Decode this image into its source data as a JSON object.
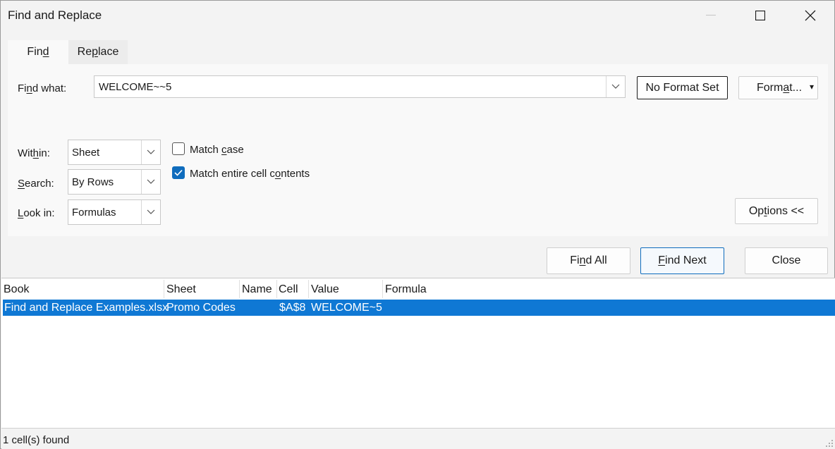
{
  "window": {
    "title": "Find and Replace"
  },
  "tabs": [
    {
      "pre": "Fin",
      "key": "d",
      "post": ""
    },
    {
      "pre": "Re",
      "key": "p",
      "post": "lace"
    }
  ],
  "find_what": {
    "label_pre": "Fi",
    "label_key": "n",
    "label_post": "d what:",
    "value": "WELCOME~~5"
  },
  "format_status": "No Format Set",
  "format_button": {
    "pre": "Form",
    "key": "a",
    "post": "t..."
  },
  "within": {
    "label_pre": "Wit",
    "label_key": "h",
    "label_post": "in:",
    "value": "Sheet"
  },
  "search": {
    "label_pre": "",
    "label_key": "S",
    "label_post": "earch:",
    "value": "By Rows"
  },
  "look_in": {
    "label_pre": "",
    "label_key": "L",
    "label_post": "ook in:",
    "value": "Formulas"
  },
  "match_case": {
    "pre": "Match ",
    "key": "c",
    "post": "ase",
    "checked": false
  },
  "match_entire": {
    "pre": "Match entire cell c",
    "key": "o",
    "post": "ntents",
    "checked": true
  },
  "options_button": {
    "pre": "Op",
    "key": "t",
    "post": "ions <<"
  },
  "find_all_button": {
    "pre": "Fi",
    "key": "n",
    "post": "d All"
  },
  "find_next_button": {
    "pre": "",
    "key": "F",
    "post": "ind Next"
  },
  "close_button": "Close",
  "results": {
    "columns": [
      "Book",
      "Sheet",
      "Name",
      "Cell",
      "Value",
      "Formula"
    ],
    "rows": [
      {
        "book": "Find and Replace Examples.xlsx",
        "sheet": "Promo Codes",
        "name": "",
        "cell": "$A$8",
        "value": "WELCOME~5",
        "formula": ""
      }
    ]
  },
  "status": "1 cell(s) found",
  "colors": {
    "accent": "#0f6cbd",
    "selection": "#0f78d4"
  }
}
